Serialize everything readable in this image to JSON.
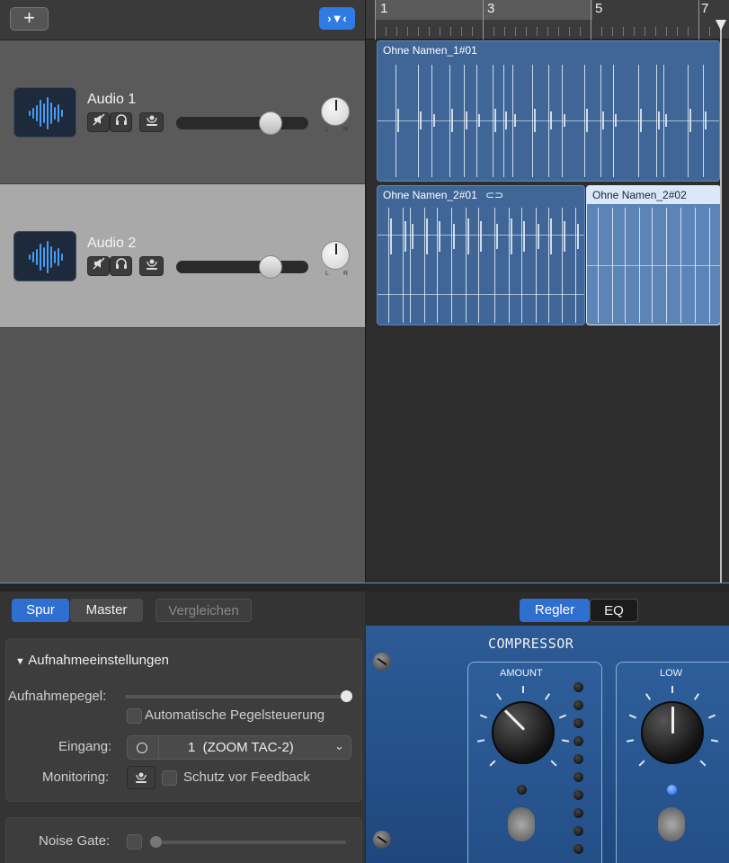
{
  "header": {
    "add_label": "+",
    "filter_label": "›▼‹"
  },
  "ruler": {
    "bars": [
      "1",
      "3",
      "5",
      "7"
    ]
  },
  "tracks": [
    {
      "name": "Audio 1",
      "selected": false,
      "volume": 0.78
    },
    {
      "name": "Audio 2",
      "selected": true,
      "volume": 0.78
    }
  ],
  "regions": [
    {
      "title": "Ohne Namen_1#01",
      "selected": false
    },
    {
      "title": "Ohne Namen_2#01",
      "selected": false
    },
    {
      "title": "Ohne Namen_2#02",
      "selected": true
    }
  ],
  "tabs": {
    "spur": "Spur",
    "master": "Master",
    "compare": "Vergleichen",
    "controls": "Regler",
    "eq": "EQ"
  },
  "recording": {
    "section_title": "Aufnahmeeinstellungen",
    "level_label": "Aufnahmepegel:",
    "level_value": 0.98,
    "auto_level_label": "Automatische Pegelsteuerung",
    "input_label": "Eingang:",
    "input_value": "1  (ZOOM TAC-2)",
    "monitoring_label": "Monitoring:",
    "feedback_label": "Schutz vor Feedback"
  },
  "noise_gate": {
    "label": "Noise Gate:",
    "value": 0.0
  },
  "compressor": {
    "title": "COMPRESSOR",
    "amount_label": "AMOUNT",
    "low_label": "LOW"
  },
  "colors": {
    "accent": "#2f6fcf",
    "region": "#3f6697",
    "compressor_bg": "#2d5b96"
  }
}
